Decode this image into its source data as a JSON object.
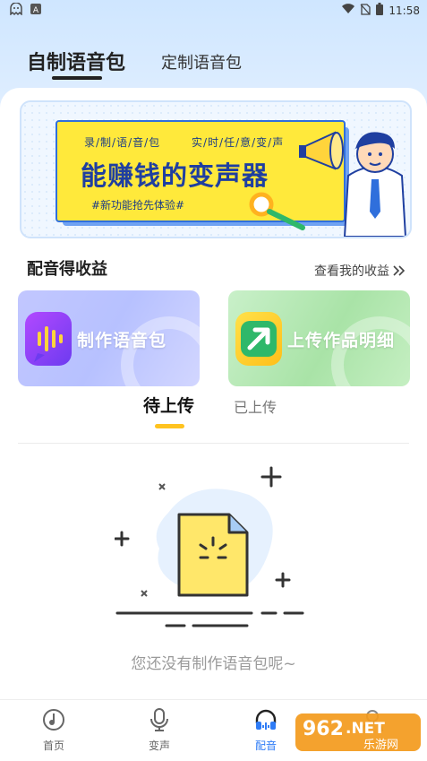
{
  "status_bar": {
    "time": "11:58",
    "left_icons": [
      "ghost-icon",
      "a-icon"
    ],
    "right_icons": [
      "wifi-icon",
      "no-sim-icon",
      "battery-icon"
    ]
  },
  "top_tabs": [
    {
      "label": "自制语音包",
      "active": true
    },
    {
      "label": "定制语音包",
      "active": false
    }
  ],
  "banner": {
    "tagline_left": "录/制/语/音/包",
    "tagline_right": "实/时/任/意/变/声",
    "title": "能赚钱的变声器",
    "subtitle": "#新功能抢先体验#"
  },
  "earnings_section": {
    "title": "配音得收益",
    "link": "查看我的收益"
  },
  "features": [
    {
      "label": "制作语音包",
      "icon": "voice-wave-icon",
      "color": "#b7c1ff"
    },
    {
      "label": "上传作品明细",
      "icon": "upload-arrow-icon",
      "color": "#a9e3a7"
    }
  ],
  "sub_tabs": [
    {
      "label": "待上传",
      "active": true
    },
    {
      "label": "已上传",
      "active": false
    }
  ],
  "empty_state": {
    "message": "您还没有制作语音包呢~",
    "icon": "empty-document-icon"
  },
  "bottom_nav": [
    {
      "label": "首页",
      "icon": "music-disc-icon",
      "active": false
    },
    {
      "label": "变声",
      "icon": "microphone-icon",
      "active": false
    },
    {
      "label": "配音",
      "icon": "headphones-icon",
      "active": true
    },
    {
      "label": "",
      "icon": "user-icon",
      "active": false
    }
  ],
  "watermark": {
    "brand": "962",
    "suffix": ".NET",
    "site_name": "乐游网"
  },
  "colors": {
    "accent": "#2f7cf6",
    "tab_indicator": "#ffc31f",
    "banner_yellow": "#ffe93b",
    "banner_blue": "#1f3fa0"
  }
}
